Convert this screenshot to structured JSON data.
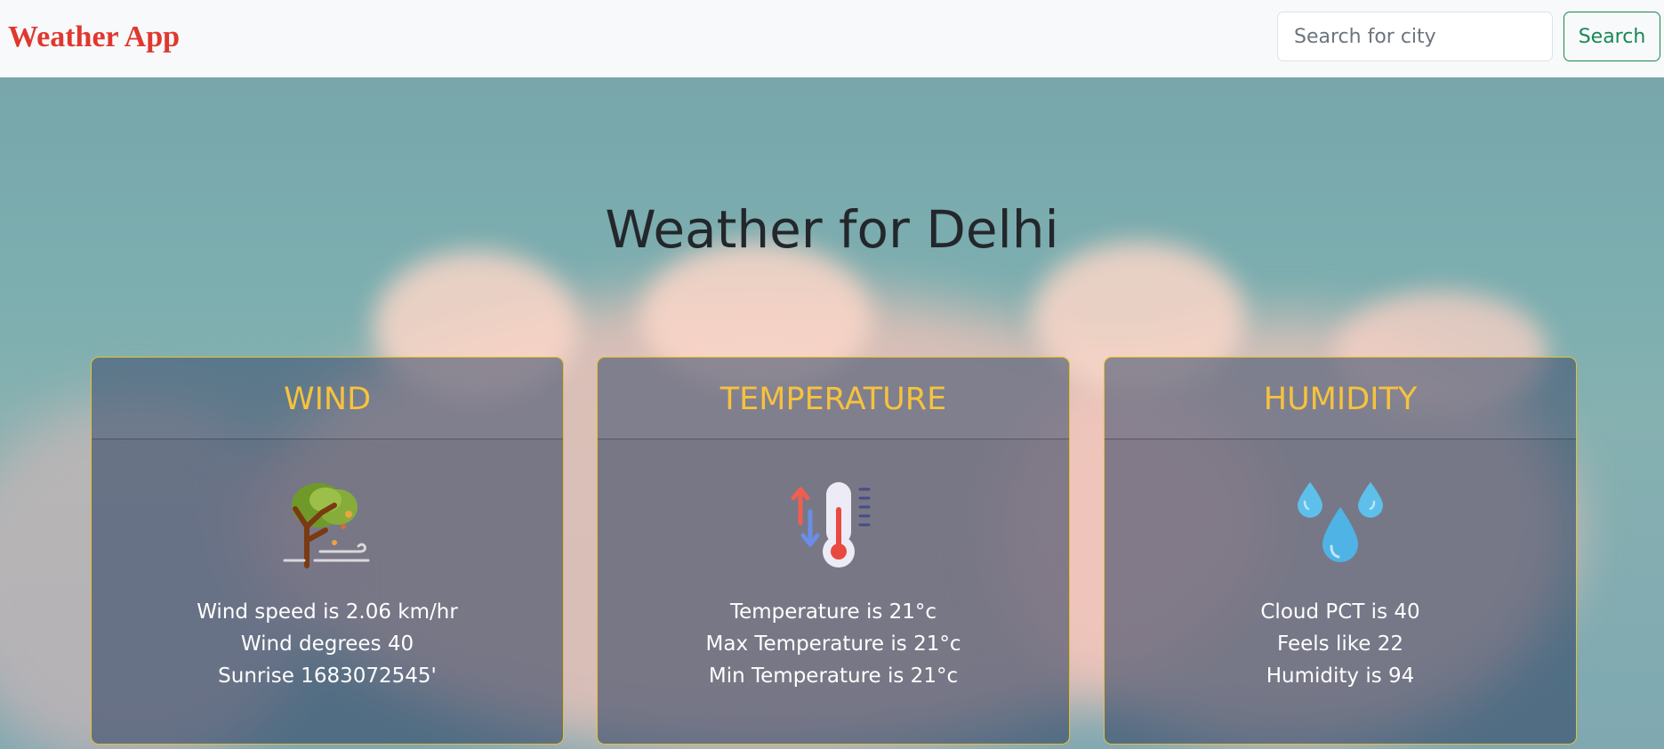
{
  "navbar": {
    "brand": "Weather App",
    "search_placeholder": "Search for city",
    "search_button": "Search"
  },
  "page_title": "Weather for Delhi",
  "cards": [
    {
      "title": "WIND",
      "icon": "wind-tree-icon",
      "lines": [
        "Wind speed is 2.06 km/hr",
        "Wind degrees 40",
        "Sunrise 1683072545'"
      ]
    },
    {
      "title": "TEMPERATURE",
      "icon": "thermometer-icon",
      "lines": [
        "Temperature is 21°c",
        "Max Temperature is 21°c",
        "Min Temperature is 21°c"
      ]
    },
    {
      "title": "HUMIDITY",
      "icon": "water-drops-icon",
      "lines": [
        "Cloud PCT is 40",
        "Feels like 22",
        "Humidity is 94"
      ]
    }
  ],
  "colors": {
    "brand": "#e0382f",
    "search_button": "#198754",
    "card_title": "#f6c23e",
    "card_border": "#e6c12a"
  }
}
